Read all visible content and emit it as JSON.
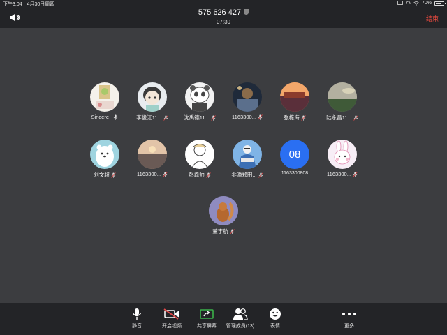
{
  "status_bar": {
    "time": "下午3:04",
    "date": "4月30日周四",
    "battery": "70%"
  },
  "header": {
    "meeting_id": "575 626 427",
    "duration": "07:30",
    "end_label": "结束"
  },
  "participants": [
    {
      "name": "Sincere~"
    },
    {
      "name": "李俊江11..."
    },
    {
      "name": "沈禹德11..."
    },
    {
      "name": "1163300..."
    },
    {
      "name": "张栋海"
    },
    {
      "name": "陆永昌11..."
    },
    {
      "name": "刘文超"
    },
    {
      "name": "1163300..."
    },
    {
      "name": "彭鑫帅"
    },
    {
      "name": "非潘郑田..."
    },
    {
      "name": "1163300808",
      "avatar_text": "08"
    },
    {
      "name": "1163300..."
    },
    {
      "name": "董宇航"
    }
  ],
  "toolbar": {
    "mute": "静音",
    "start_video": "开启视频",
    "share_screen": "共享屏幕",
    "manage_members": "管理成员(13)",
    "emoji": "表情",
    "more": "更多"
  },
  "colors": {
    "end_red": "#e4483e",
    "id_blue": "#2a6ff2",
    "share_green": "#3bb24a"
  }
}
